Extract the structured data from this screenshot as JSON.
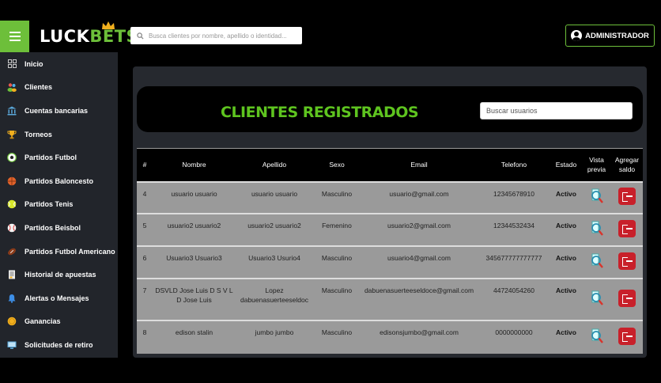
{
  "brand": {
    "part1": "LUCK",
    "part2": "BETS"
  },
  "top_search": {
    "placeholder": "Busca clientes por nombre, apellido o identidad..."
  },
  "admin": {
    "label": "ADMINISTRADOR"
  },
  "sidebar": {
    "items": [
      {
        "label": "Inicio",
        "icon": "grid-icon"
      },
      {
        "label": "Clientes",
        "icon": "users-icon"
      },
      {
        "label": "Cuentas bancarias",
        "icon": "bank-icon"
      },
      {
        "label": "Torneos",
        "icon": "trophy-icon"
      },
      {
        "label": "Partidos Futbol",
        "icon": "soccer-ball-icon"
      },
      {
        "label": "Partidos Baloncesto",
        "icon": "basketball-icon"
      },
      {
        "label": "Partidos Tenis",
        "icon": "tennis-ball-icon"
      },
      {
        "label": "Partidos Beisbol",
        "icon": "baseball-icon"
      },
      {
        "label": "Partidos Futbol Americano",
        "icon": "football-icon"
      },
      {
        "label": "Historial de apuestas",
        "icon": "document-icon"
      },
      {
        "label": "Alertas o Mensajes",
        "icon": "bell-icon"
      },
      {
        "label": "Ganancias",
        "icon": "coin-icon"
      },
      {
        "label": "Solicitudes de retiro",
        "icon": "monitor-icon"
      }
    ]
  },
  "page": {
    "title": "CLIENTES REGISTRADOS",
    "search_placeholder": "Buscar usuarios"
  },
  "table": {
    "headers": [
      "#",
      "Nombre",
      "Apellido",
      "Sexo",
      "Email",
      "Telefono",
      "Estado",
      "Vista previa",
      "Agregar saldo"
    ],
    "rows": [
      {
        "id": "4",
        "nombre": "usuario usuario",
        "apellido": "usuario usuario",
        "sexo": "Masculino",
        "email": "usuario@gmail.com",
        "telefono": "12345678910",
        "estado": "Activo"
      },
      {
        "id": "5",
        "nombre": "usuario2 usuario2",
        "apellido": "usuario2 usuario2",
        "sexo": "Femenino",
        "email": "usuario2@gmail.com",
        "telefono": "12344532434",
        "estado": "Activo"
      },
      {
        "id": "6",
        "nombre": "Usuario3 Usuario3",
        "apellido": "Usuario3 Usurio4",
        "sexo": "Masculino",
        "email": "usuario4@gmail.com",
        "telefono": "345677777777777",
        "estado": "Activo"
      },
      {
        "id": "7",
        "nombre": "DSVLD Jose Luis D S V L D Jose Luis",
        "apellido": "Lopez dabuenasuerteeseldoc",
        "sexo": "Masculino",
        "email": "dabuenasuerteeseldoce@gmail.com",
        "telefono": "44724054260",
        "estado": "Activo"
      },
      {
        "id": "8",
        "nombre": "edison stalin",
        "apellido": "jumbo jumbo",
        "sexo": "Masculino",
        "email": "edisonsjumbo@gmail.com",
        "telefono": "0000000000",
        "estado": "Activo"
      }
    ]
  },
  "colors": {
    "accent": "#6dbf3a",
    "title": "#5ec41f",
    "sidebar": "#22252b",
    "danger": "#c8202a"
  }
}
